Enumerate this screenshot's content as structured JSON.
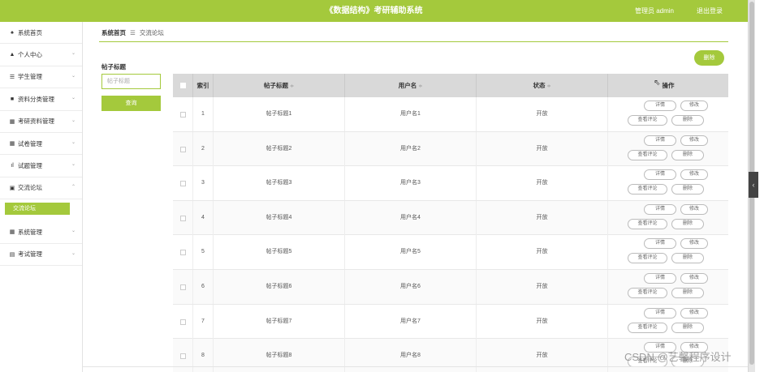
{
  "header": {
    "title": "《数据结构》考研辅助系统",
    "admin_label": "管理员 admin",
    "logout_label": "退出登录"
  },
  "sidebar": {
    "items": [
      {
        "label": "系统首页",
        "icon": "home-icon",
        "glyph": "♠",
        "chevron": ""
      },
      {
        "label": "个人中心",
        "icon": "user-icon",
        "glyph": "▲",
        "chevron": "⌄"
      },
      {
        "label": "学生管理",
        "icon": "list-icon",
        "glyph": "☰",
        "chevron": "⌄"
      },
      {
        "label": "资料分类管理",
        "icon": "folder-icon",
        "glyph": "■",
        "chevron": "⌄"
      },
      {
        "label": "考研资料管理",
        "icon": "grid-icon",
        "glyph": "▦",
        "chevron": "⌄"
      },
      {
        "label": "试卷管理",
        "icon": "grid-icon",
        "glyph": "▦",
        "chevron": "⌄"
      },
      {
        "label": "试题管理",
        "icon": "bar-chart-icon",
        "glyph": "ıl",
        "chevron": "⌄"
      },
      {
        "label": "交流论坛",
        "icon": "forum-icon",
        "glyph": "▣",
        "chevron": "⌃"
      }
    ],
    "submenu": {
      "label": "交流论坛"
    },
    "items_after": [
      {
        "label": "系统管理",
        "icon": "grid-icon",
        "glyph": "▦",
        "chevron": "⌄"
      },
      {
        "label": "考试管理",
        "icon": "exam-icon",
        "glyph": "▤",
        "chevron": "⌄"
      }
    ]
  },
  "breadcrumb": {
    "home": "系统首页",
    "separator": "☰",
    "current": "交流论坛"
  },
  "filter": {
    "label": "帖子标题",
    "placeholder": "帖子标题",
    "query_label": "查询"
  },
  "toolbar": {
    "delete_label": "删除"
  },
  "table": {
    "columns": [
      {
        "label": "索引",
        "sortable": false
      },
      {
        "label": "帖子标题",
        "sortable": true
      },
      {
        "label": "用户名",
        "sortable": true
      },
      {
        "label": "状态",
        "sortable": true
      },
      {
        "label": "操作",
        "sortable": false
      }
    ],
    "sort_glyph": "≑",
    "rows": [
      {
        "index": "1",
        "title": "帖子标题1",
        "username": "用户名1",
        "status": "开放"
      },
      {
        "index": "2",
        "title": "帖子标题2",
        "username": "用户名2",
        "status": "开放"
      },
      {
        "index": "3",
        "title": "帖子标题3",
        "username": "用户名3",
        "status": "开放"
      },
      {
        "index": "4",
        "title": "帖子标题4",
        "username": "用户名4",
        "status": "开放"
      },
      {
        "index": "5",
        "title": "帖子标题5",
        "username": "用户名5",
        "status": "开放"
      },
      {
        "index": "6",
        "title": "帖子标题6",
        "username": "用户名6",
        "status": "开放"
      },
      {
        "index": "7",
        "title": "帖子标题7",
        "username": "用户名7",
        "status": "开放"
      },
      {
        "index": "8",
        "title": "帖子标题8",
        "username": "用户名8",
        "status": "开放"
      }
    ],
    "actions": {
      "detail": "详情",
      "edit": "修改",
      "comments": "查看评论",
      "delete": "删除"
    }
  },
  "watermark": "CSDN @艺馨程序设计",
  "colors": {
    "accent": "#a4c93c",
    "header_bg": "#d9d9d9"
  }
}
